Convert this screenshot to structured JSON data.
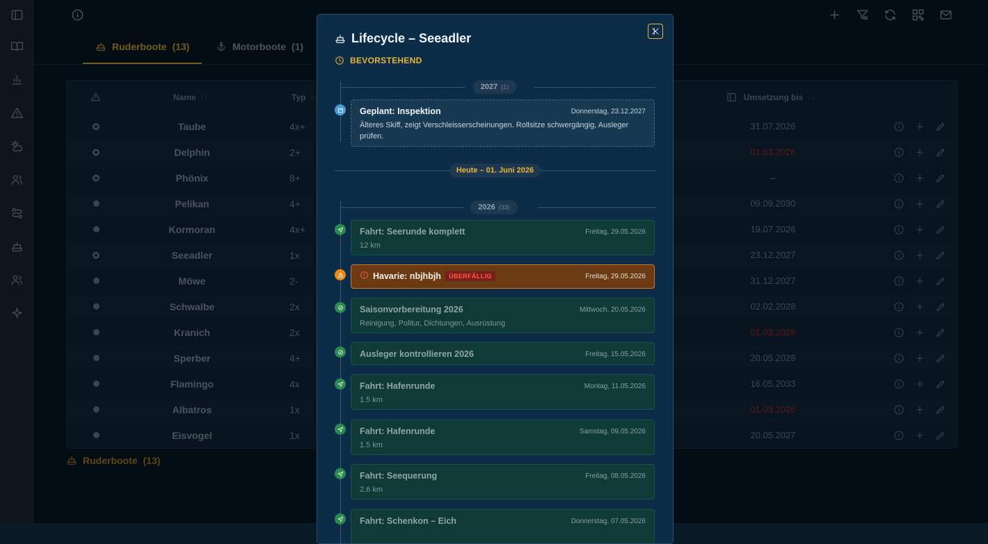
{
  "tabs": [
    {
      "label": "Ruderboote",
      "count": "(13)"
    },
    {
      "label": "Motorboote",
      "count": "(1)"
    }
  ],
  "table": {
    "headers": {
      "name": "Name",
      "typ": "Typ",
      "umsetzung": "Umsetzung bis"
    },
    "rows": [
      {
        "status": "ring",
        "name": "Taube",
        "typ": "4x+",
        "date": "31.07.2026",
        "date_red": false
      },
      {
        "status": "ring",
        "name": "Delphin",
        "typ": "2+",
        "date": "01.03.2026",
        "date_red": true
      },
      {
        "status": "ring",
        "name": "Phönix",
        "typ": "8+",
        "date": "–",
        "date_red": false
      },
      {
        "status": "dot",
        "name": "Pelikan",
        "typ": "4+",
        "date": "09.09.2030",
        "date_red": false
      },
      {
        "status": "dot",
        "name": "Kormoran",
        "typ": "4x+",
        "date": "19.07.2026",
        "date_red": false
      },
      {
        "status": "ring",
        "name": "Seeadler",
        "typ": "1x",
        "date": "23.12.2027",
        "date_red": false
      },
      {
        "status": "dot",
        "name": "Möwe",
        "typ": "2-",
        "date": "31.12.2027",
        "date_red": false
      },
      {
        "status": "dot",
        "name": "Schwalbe",
        "typ": "2x",
        "date": "02.02.2028",
        "date_red": false
      },
      {
        "status": "dot",
        "name": "Kranich",
        "typ": "2x",
        "date": "01.03.2026",
        "date_red": true
      },
      {
        "status": "dot",
        "name": "Sperber",
        "typ": "4+",
        "date": "20.05.2028",
        "date_red": false
      },
      {
        "status": "dot",
        "name": "Flamingo",
        "typ": "4x",
        "date": "16.05.2033",
        "date_red": false
      },
      {
        "status": "dot",
        "name": "Albatros",
        "typ": "1x",
        "date": "01.03.2026",
        "date_red": true
      },
      {
        "status": "dot",
        "name": "Eisvogel",
        "typ": "1x",
        "date": "20.05.2027",
        "date_red": false
      }
    ]
  },
  "footer": {
    "label": "Ruderboote",
    "count": "(13)"
  },
  "modal": {
    "title": "Lifecycle – Seeadler",
    "status": "BEVORSTEHEND",
    "year_2027": {
      "label": "2027",
      "count": "(1)"
    },
    "today": "Heute – 01. Juni 2026",
    "year_2026": {
      "label": "2026",
      "count": "(33)"
    },
    "events": [
      {
        "kind": "planned",
        "title": "Geplant: Inspektion",
        "date": "Donnerstag, 23.12.2027",
        "body": "Älteres Skiff, zeigt Verschleisserscheinungen. Rollsitze schwergängig, Ausleger prüfen."
      },
      {
        "kind": "trip",
        "title": "Fahrt: Seerunde komplett",
        "date": "Freitag, 29.05.2026",
        "body": "12 km"
      },
      {
        "kind": "alarm",
        "title": "Havarie: nbjhbjh",
        "badge": "ÜBERFÄLLIG",
        "date": "Freitag, 29.05.2026"
      },
      {
        "kind": "check",
        "title": "Saisonvorbereitung 2026",
        "date": "Mittwoch, 20.05.2026",
        "body": "Reinigung, Politur, Dichtungen, Ausrüstung"
      },
      {
        "kind": "check",
        "title": "Ausleger kontrollieren 2026",
        "date": "Freitag, 15.05.2026"
      },
      {
        "kind": "trip",
        "title": "Fahrt: Hafenrunde",
        "date": "Montag, 11.05.2026",
        "body": "1.5 km"
      },
      {
        "kind": "trip",
        "title": "Fahrt: Hafenrunde",
        "date": "Samstag, 09.05.2026",
        "body": "1.5 km"
      },
      {
        "kind": "trip",
        "title": "Fahrt: Seequerung",
        "date": "Freitag, 08.05.2026",
        "body": "2.6 km"
      },
      {
        "kind": "trip",
        "title": "Fahrt: Schenkon – Eich",
        "date": "Donnerstag, 07.05.2026"
      }
    ]
  }
}
